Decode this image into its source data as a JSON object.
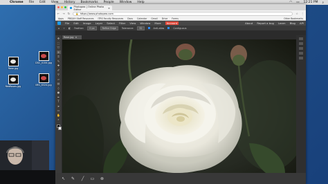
{
  "menubar": {
    "apple": "",
    "app_name": "Chrome",
    "items": [
      "File",
      "Edit",
      "View",
      "History",
      "Bookmarks",
      "People",
      "Window",
      "Help"
    ],
    "clock": "12:21 PM"
  },
  "desktop": {
    "files": [
      {
        "label": "Rose.jpg",
        "thumb": "white-rose"
      },
      {
        "label": "DSC_0154.jpg",
        "thumb": "red-rose"
      },
      {
        "label": "RedRoses.jpg",
        "thumb": "white-rose"
      },
      {
        "label": "IMG_6324.jpg",
        "thumb": "red-rose"
      }
    ]
  },
  "browser": {
    "tab_title": "Photopea | Online Photo Editor",
    "url": "https://www.photopea.com",
    "bookmarks": [
      "Apps",
      "PBS/UH Staff Resources",
      "ITRS Faculty Resources",
      "Docs",
      "Calendar",
      "Gmail",
      "Drive",
      "Forms"
    ],
    "bookmarks_right": "Other Bookmarks"
  },
  "photopea": {
    "menu": [
      "File",
      "Edit",
      "Image",
      "Layer",
      "Select",
      "Filter",
      "View",
      "Window",
      "More"
    ],
    "active_menu": "Account",
    "menu_right": [
      "About",
      "Report a bug",
      "Learn",
      "Blog",
      "API"
    ],
    "options": {
      "feather_label": "Feather:",
      "feather_value": "0 px",
      "refine_label": "Refine Edge",
      "tolerance_label": "Tolerance:",
      "tolerance_value": "32",
      "anti_alias_label": "Anti-alias",
      "anti_alias_on": true,
      "contiguous_label": "Contiguous",
      "contiguous_on": true
    },
    "document_tab": "Rose.jpg"
  },
  "colors": {
    "accent": "#e0483a",
    "photopea_blue": "#1e9be9",
    "ui_dark": "#3a3a3a"
  }
}
